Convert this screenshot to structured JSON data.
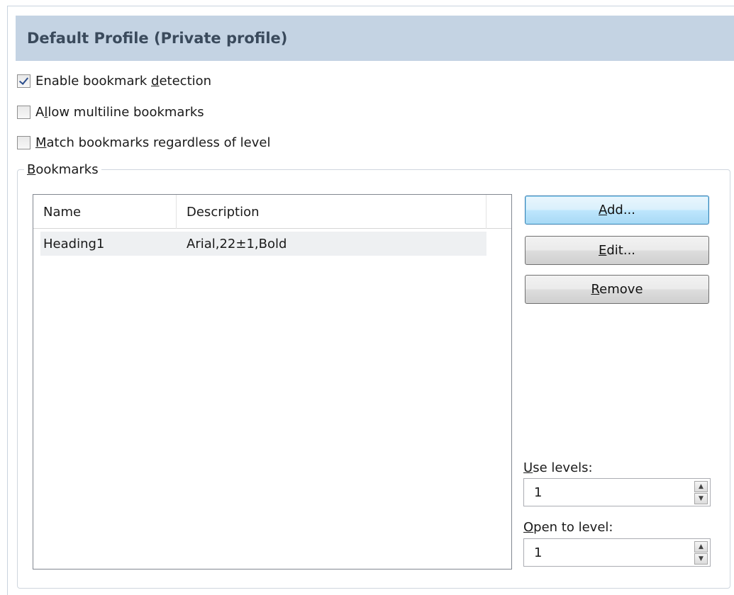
{
  "profile": {
    "title": "Default Profile (Private profile)"
  },
  "options": [
    {
      "label_pre": "Enable bookmark ",
      "label_u": "d",
      "label_post": "etection",
      "checked": true
    },
    {
      "label_pre": "A",
      "label_u": "l",
      "label_post": "low multiline bookmarks",
      "checked": false
    },
    {
      "label_pre": "",
      "label_u": "M",
      "label_post": "atch bookmarks regardless of level",
      "checked": false
    }
  ],
  "bookmarks_group": {
    "label_u": "B",
    "label_post": "ookmarks"
  },
  "list": {
    "columns": [
      "Name",
      "Description"
    ],
    "rows": [
      {
        "name": "Heading1",
        "description": "Arial,22±1,Bold"
      }
    ]
  },
  "buttons": {
    "add": {
      "label_u": "A",
      "label_post": "dd..."
    },
    "edit": {
      "label_u": "E",
      "label_post": "dit..."
    },
    "remove": {
      "label_u": "R",
      "label_post": "emove"
    }
  },
  "use_levels": {
    "label_u": "U",
    "label_post": "se levels:",
    "value": "1"
  },
  "open_to_level": {
    "label_u": "O",
    "label_post": "pen to level:",
    "value": "1"
  },
  "colors": {
    "header_bg": "#c4d3e3",
    "header_text": "#3a4a5c",
    "default_button": "#bee6fd"
  },
  "icons": [
    "checkbox-checked",
    "checkbox-unchecked",
    "spin-up-arrow",
    "spin-down-arrow"
  ]
}
